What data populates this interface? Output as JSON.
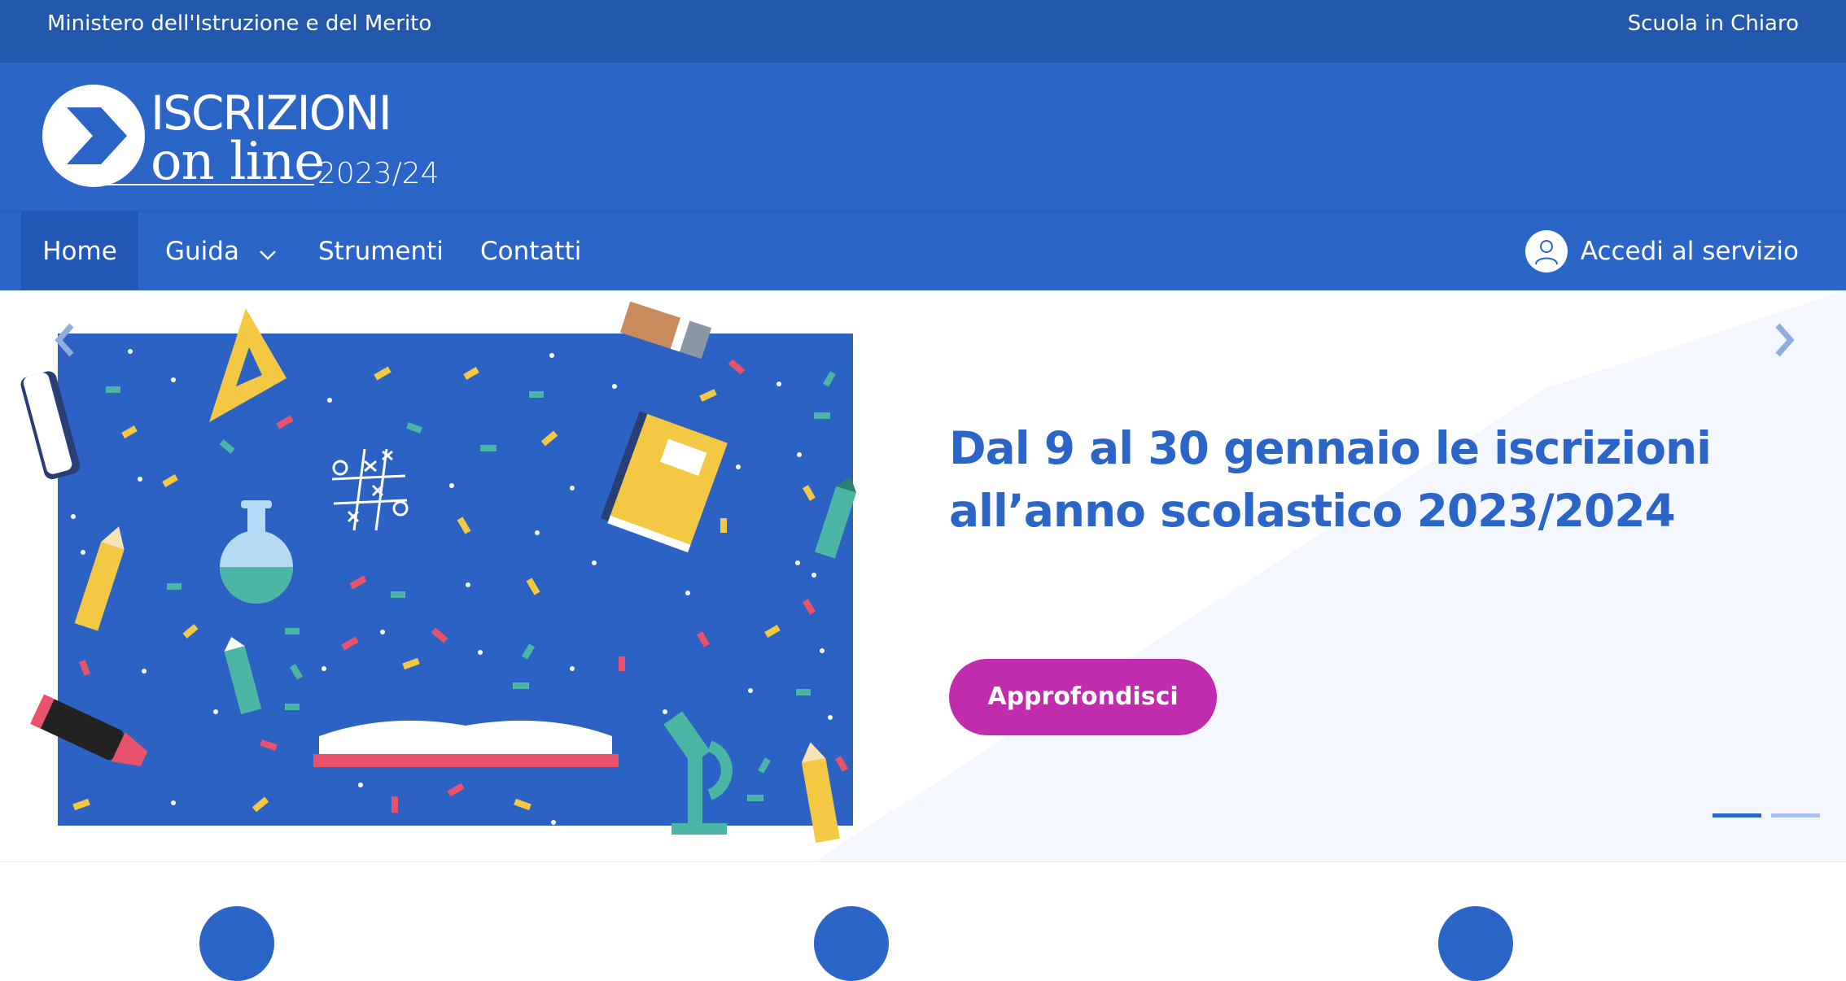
{
  "topbar": {
    "ministry": "Ministero dell'Istruzione e del Merito",
    "link": "Scuola in Chiaro"
  },
  "logo": {
    "title": "ISCRIZIONI",
    "subtitle": "on line",
    "year": "2023/24"
  },
  "nav": {
    "items": [
      {
        "label": "Home"
      },
      {
        "label": "Guida"
      },
      {
        "label": "Strumenti"
      },
      {
        "label": "Contatti"
      }
    ],
    "login": "Accedi al servizio"
  },
  "hero": {
    "title_line1": "Dal 9 al 30 gennaio le iscrizioni",
    "title_line2": "all’anno scolastico 2023/2024",
    "cta": "Approfondisci",
    "active_slide": 1,
    "slide_count": 2
  },
  "colors": {
    "topbar": "#2359ad",
    "primary": "#2b65c8",
    "cta": "#c12bad"
  },
  "icons": [
    "logo-chevron-icon",
    "chevron-down-icon",
    "user-icon",
    "chevron-left-icon",
    "chevron-right-icon"
  ]
}
